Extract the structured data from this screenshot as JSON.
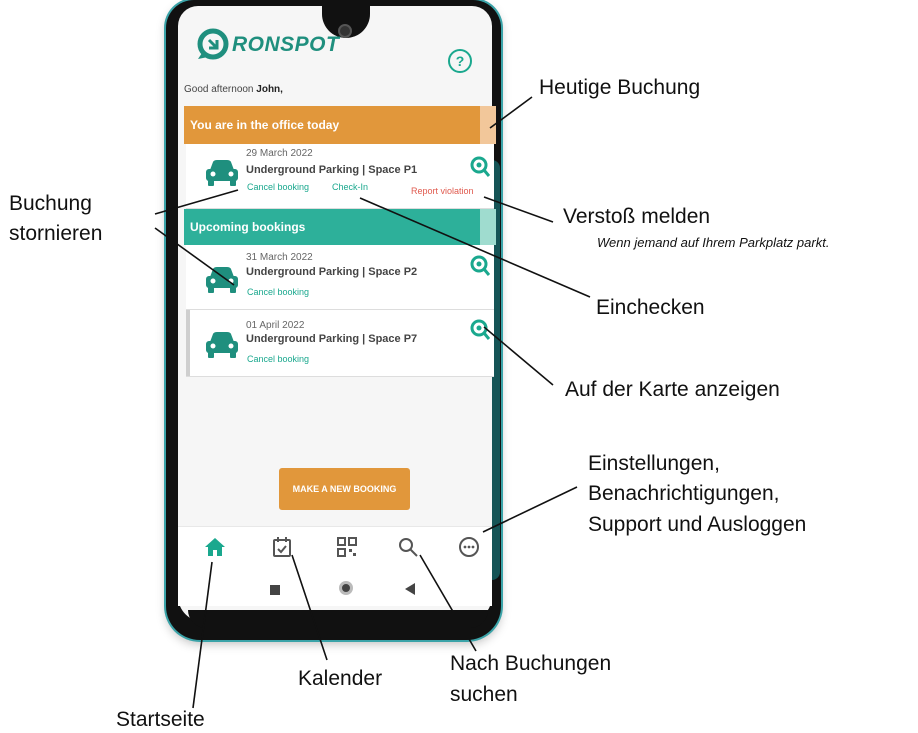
{
  "app": {
    "logo_text": "RONSPOT",
    "greeting_prefix": "Good afternoon",
    "user_name": "John,"
  },
  "today": {
    "banner": "You are in the office today",
    "booking": {
      "date": "29 March 2022",
      "location": "Underground Parking | Space P1",
      "cancel": "Cancel booking",
      "checkin": "Check-In",
      "report": "Report violation"
    }
  },
  "upcoming": {
    "banner": "Upcoming bookings",
    "bookings": [
      {
        "date": "31 March 2022",
        "location": "Underground Parking | Space P2",
        "cancel": "Cancel booking"
      },
      {
        "date": "01 April 2022",
        "location": "Underground Parking | Space P7",
        "cancel": "Cancel booking"
      }
    ]
  },
  "new_booking_label": "MAKE A NEW BOOKING",
  "tabs": [
    "home-icon",
    "calendar-icon",
    "qr-code-icon",
    "search-icon",
    "more-icon"
  ],
  "colors": {
    "accent_green": "#1aa88e",
    "banner_orange": "#e1973b",
    "banner_teal": "#2db09a",
    "violation_red": "#e05a4e"
  },
  "annotations": {
    "today_booking": "Heutige Buchung",
    "cancel_line1": "Buchung",
    "cancel_line2": "stornieren",
    "report_violation": "Verstoß melden",
    "report_violation_sub": "Wenn jemand auf Ihrem Parkplatz parkt.",
    "checkin": "Einchecken",
    "show_map": "Auf der Karte anzeigen",
    "settings_line1": "Einstellungen,",
    "settings_line2": "Benachrichtigungen,",
    "settings_line3": "Support und Ausloggen",
    "search_line1": "Nach Buchungen",
    "search_line2": "suchen",
    "calendar": "Kalender",
    "home": "Startseite"
  }
}
